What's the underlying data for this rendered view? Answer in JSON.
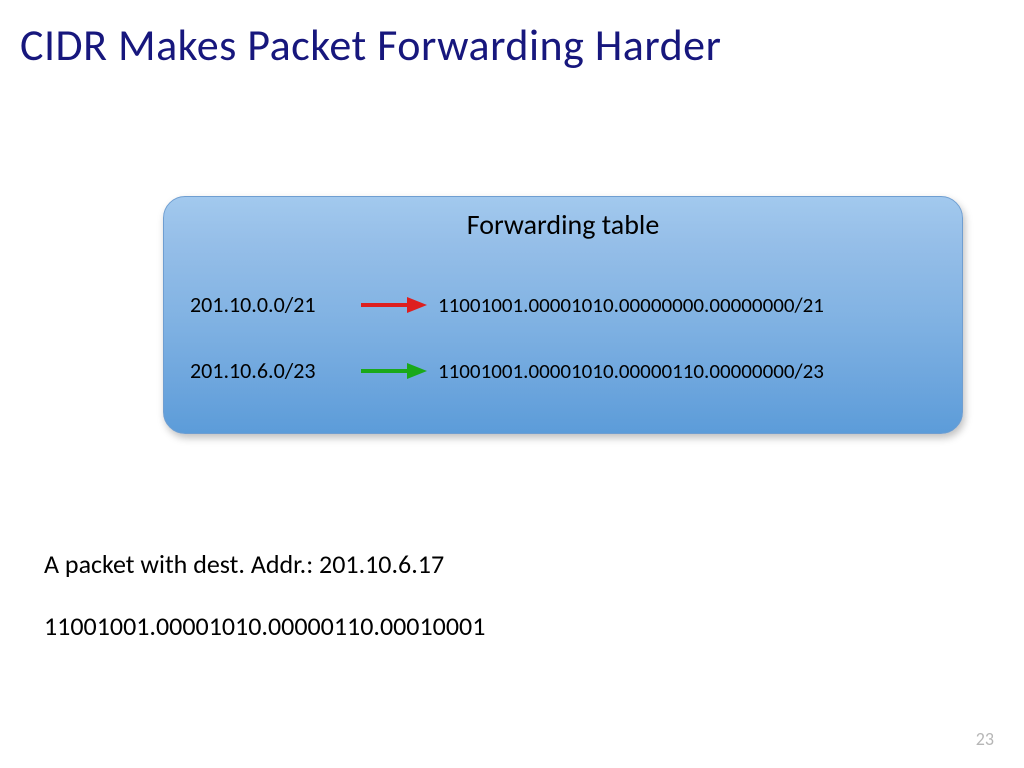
{
  "title": "CIDR Makes Packet Forwarding Harder",
  "panel": {
    "heading": "Forwarding table",
    "rows": [
      {
        "cidr": "201.10.0.0/21",
        "binary": "11001001.00001010.00000000.00000000/21",
        "arrow_color": "#dd1f1f"
      },
      {
        "cidr": "201.10.6.0/23",
        "binary": "11001001.00001010.00000110.00000000/23",
        "arrow_color": "#1aa91a"
      }
    ]
  },
  "packet": {
    "line1": "A packet with dest. Addr.: 201.10.6.17",
    "line2": "11001001.00001010.00000110.00010001"
  },
  "page_number": "23"
}
